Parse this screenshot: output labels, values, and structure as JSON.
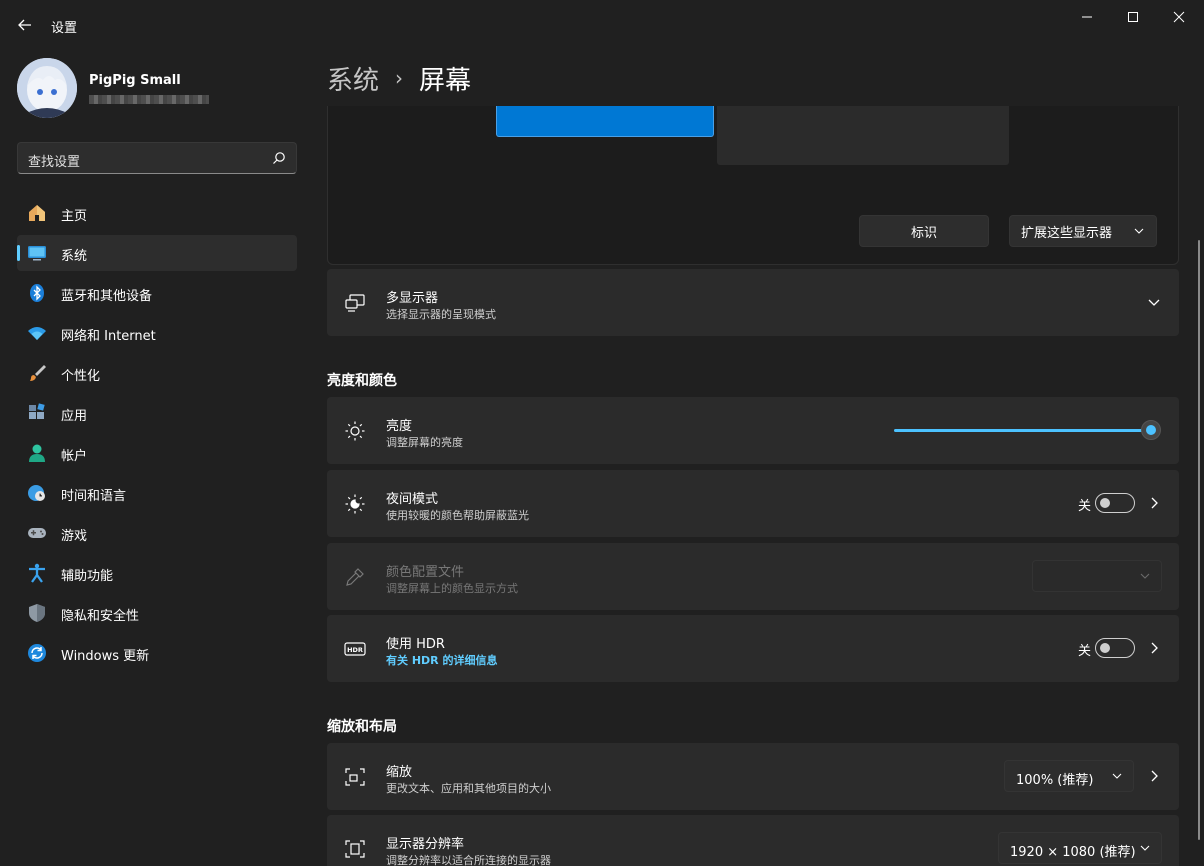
{
  "app": {
    "title": "设置"
  },
  "user": {
    "name": "PigPig Small"
  },
  "search": {
    "placeholder": "查找设置"
  },
  "sidebar": {
    "items": [
      {
        "label": "主页",
        "icon": "home-icon"
      },
      {
        "label": "系统",
        "icon": "system-icon",
        "selected": true
      },
      {
        "label": "蓝牙和其他设备",
        "icon": "bluetooth-icon"
      },
      {
        "label": "网络和 Internet",
        "icon": "wifi-icon"
      },
      {
        "label": "个性化",
        "icon": "brush-icon"
      },
      {
        "label": "应用",
        "icon": "apps-icon"
      },
      {
        "label": "帐户",
        "icon": "account-icon"
      },
      {
        "label": "时间和语言",
        "icon": "globe-clock-icon"
      },
      {
        "label": "游戏",
        "icon": "gamepad-icon"
      },
      {
        "label": "辅助功能",
        "icon": "accessibility-icon"
      },
      {
        "label": "隐私和安全性",
        "icon": "shield-icon"
      },
      {
        "label": "Windows 更新",
        "icon": "update-icon"
      }
    ]
  },
  "breadcrumb": {
    "parent": "系统",
    "separator": "›",
    "current": "屏幕"
  },
  "display_panel": {
    "identify_label": "标识",
    "extend_label": "扩展这些显示器"
  },
  "multi_display": {
    "title": "多显示器",
    "subtitle": "选择显示器的呈现模式"
  },
  "brightness_section": {
    "title": "亮度和颜色",
    "brightness": {
      "title": "亮度",
      "subtitle": "调整屏幕的亮度",
      "value_percent": 100
    },
    "night_light": {
      "title": "夜间模式",
      "subtitle": "使用较暖的颜色帮助屏蔽蓝光",
      "state": "关"
    },
    "color_profile": {
      "title": "颜色配置文件",
      "subtitle": "调整屏幕上的颜色显示方式",
      "selected": ""
    },
    "hdr": {
      "title": "使用 HDR",
      "link": "有关 HDR 的详细信息",
      "state": "关"
    }
  },
  "scale_section": {
    "title": "缩放和布局",
    "scale": {
      "title": "缩放",
      "subtitle": "更改文本、应用和其他项目的大小",
      "selected": "100% (推荐)"
    },
    "resolution": {
      "title": "显示器分辨率",
      "subtitle": "调整分辨率以适合所连接的显示器",
      "selected": "1920 × 1080 (推荐)"
    }
  },
  "colors": {
    "accent": "#60cdff",
    "slider": "#4cc2ff",
    "selected_monitor": "#0078d4",
    "background": "#202020",
    "card": "#2b2b2b"
  }
}
